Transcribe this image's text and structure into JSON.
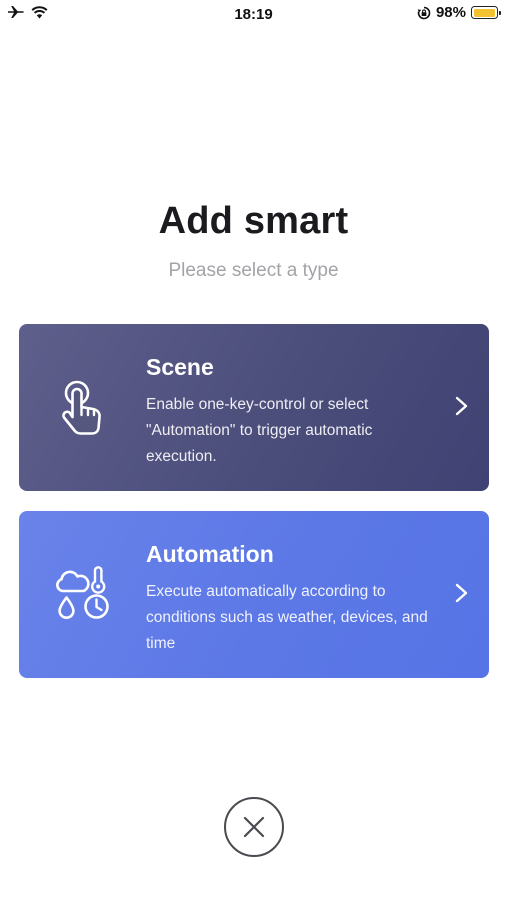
{
  "status_bar": {
    "time": "18:19",
    "battery_percent": "98%",
    "battery_level": 0.98,
    "icons": [
      "airplane-icon",
      "wifi-icon",
      "orientation-lock-icon",
      "battery-icon"
    ],
    "battery_color": "#f2c230"
  },
  "header": {
    "title": "Add smart",
    "subtitle": "Please select a type"
  },
  "cards": [
    {
      "id": "scene",
      "title": "Scene",
      "description": "Enable one-key-control or select \"Automation\" to trigger automatic execution.",
      "icon": "tap-hand-icon",
      "color": "#4b4d7a"
    },
    {
      "id": "automation",
      "title": "Automation",
      "description": "Execute automatically according to conditions such as weather, devices, and time",
      "icon": "weather-conditions-icon",
      "color": "#5c78e6"
    }
  ],
  "close": {
    "icon": "close-icon"
  }
}
